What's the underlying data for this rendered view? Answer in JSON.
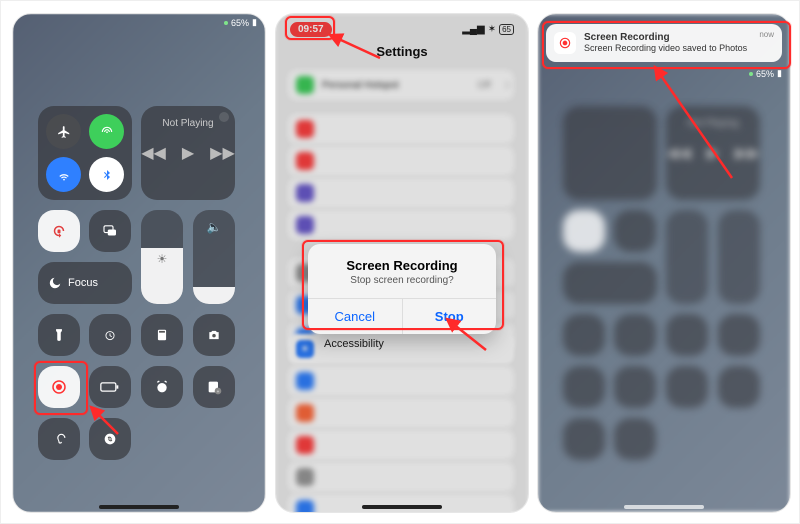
{
  "battery_percent": "65%",
  "control_center": {
    "not_playing": "Not Playing",
    "focus_label": "Focus"
  },
  "settings_screen": {
    "time": "09:57",
    "battery_pill": "65",
    "title": "Settings",
    "hotspot_label": "Personal Hotspot",
    "hotspot_value": "Off",
    "accessibility_label": "Accessibility",
    "dialog": {
      "title": "Screen Recording",
      "message": "Stop screen recording?",
      "cancel": "Cancel",
      "stop": "Stop"
    }
  },
  "notification": {
    "title": "Screen Recording",
    "body": "Screen Recording video saved to Photos",
    "when": "now"
  }
}
